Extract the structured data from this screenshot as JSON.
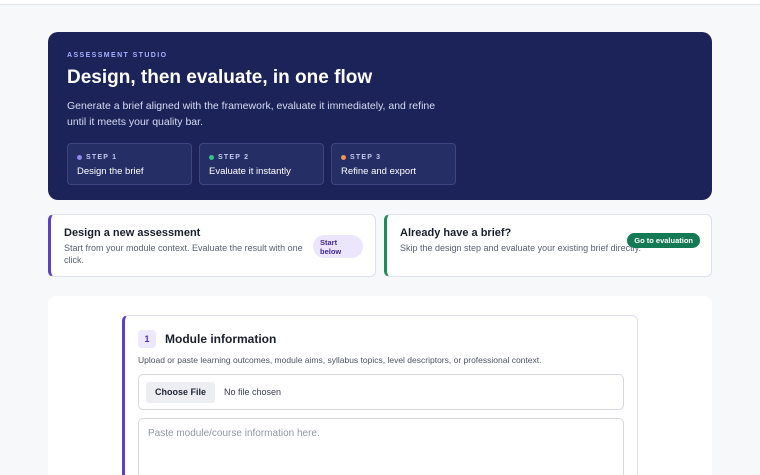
{
  "hero": {
    "eyebrow": "ASSESSMENT STUDIO",
    "title": "Design, then evaluate, in one flow",
    "subtitle": "Generate a brief aligned with the framework, evaluate it immediately, and refine until it meets your quality bar.",
    "steps": [
      {
        "tag": "STEP 1",
        "label": "Design the brief",
        "dot_color": "#8f86f0"
      },
      {
        "tag": "STEP 2",
        "label": "Evaluate it instantly",
        "dot_color": "#36c08a"
      },
      {
        "tag": "STEP 3",
        "label": "Refine and export",
        "dot_color": "#f0954a"
      }
    ]
  },
  "cards": {
    "new": {
      "title": "Design a new assessment",
      "desc": "Start from your module context. Evaluate the result with one click.",
      "pill": "Start below"
    },
    "existing": {
      "title": "Already have a brief?",
      "desc": "Skip the design step and evaluate your existing brief directly.",
      "button": "Go to evaluation"
    }
  },
  "module": {
    "number": "1",
    "title": "Module information",
    "desc": "Upload or paste learning outcomes, module aims, syllabus topics, level descriptors, or professional context.",
    "file_button": "Choose File",
    "file_status": "No file chosen",
    "textarea_placeholder": "Paste module/course information here.",
    "textarea_value": ""
  },
  "colors": {
    "hero_bg": "#1c2359",
    "accent_purple": "#5c3ec9",
    "accent_green": "#1f8a5b"
  }
}
